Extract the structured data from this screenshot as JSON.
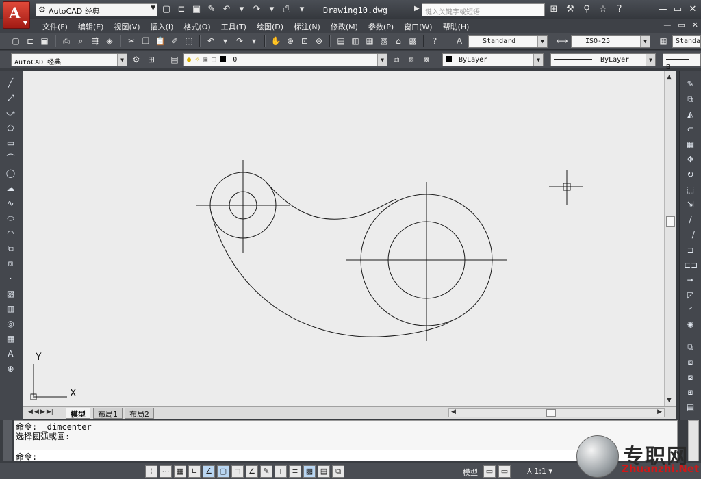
{
  "titlebar": {
    "app_letter": "A",
    "workspace": "AutoCAD 经典",
    "document_title": "Drawing10.dwg",
    "search_placeholder": "键入关键字或短语"
  },
  "menubar": {
    "items": [
      "文件(F)",
      "编辑(E)",
      "视图(V)",
      "插入(I)",
      "格式(O)",
      "工具(T)",
      "绘图(D)",
      "标注(N)",
      "修改(M)",
      "参数(P)",
      "窗口(W)",
      "帮助(H)"
    ]
  },
  "toolbar1": {
    "text_style": "Standard",
    "dim_style": "ISO-25",
    "table_style": "Standa"
  },
  "toolbar2": {
    "workspace": "AutoCAD 经典",
    "layer": "0",
    "color": "ByLayer",
    "linetype": "ByLayer",
    "lineweight": "B"
  },
  "ucs": {
    "x_label": "X",
    "y_label": "Y"
  },
  "layout_tabs": [
    "模型",
    "布局1",
    "布局2"
  ],
  "command": {
    "history": [
      "命令: _dimcenter",
      "选择圆弧或圆:"
    ],
    "prompt": "命令:"
  },
  "statusbar": {
    "model": "模型",
    "scale": "1:1"
  },
  "watermark": {
    "text": "专职网",
    "url": "Zhuanzhi.Net"
  },
  "colors": {
    "canvas": "#ececec",
    "accent": "#c0281c"
  }
}
